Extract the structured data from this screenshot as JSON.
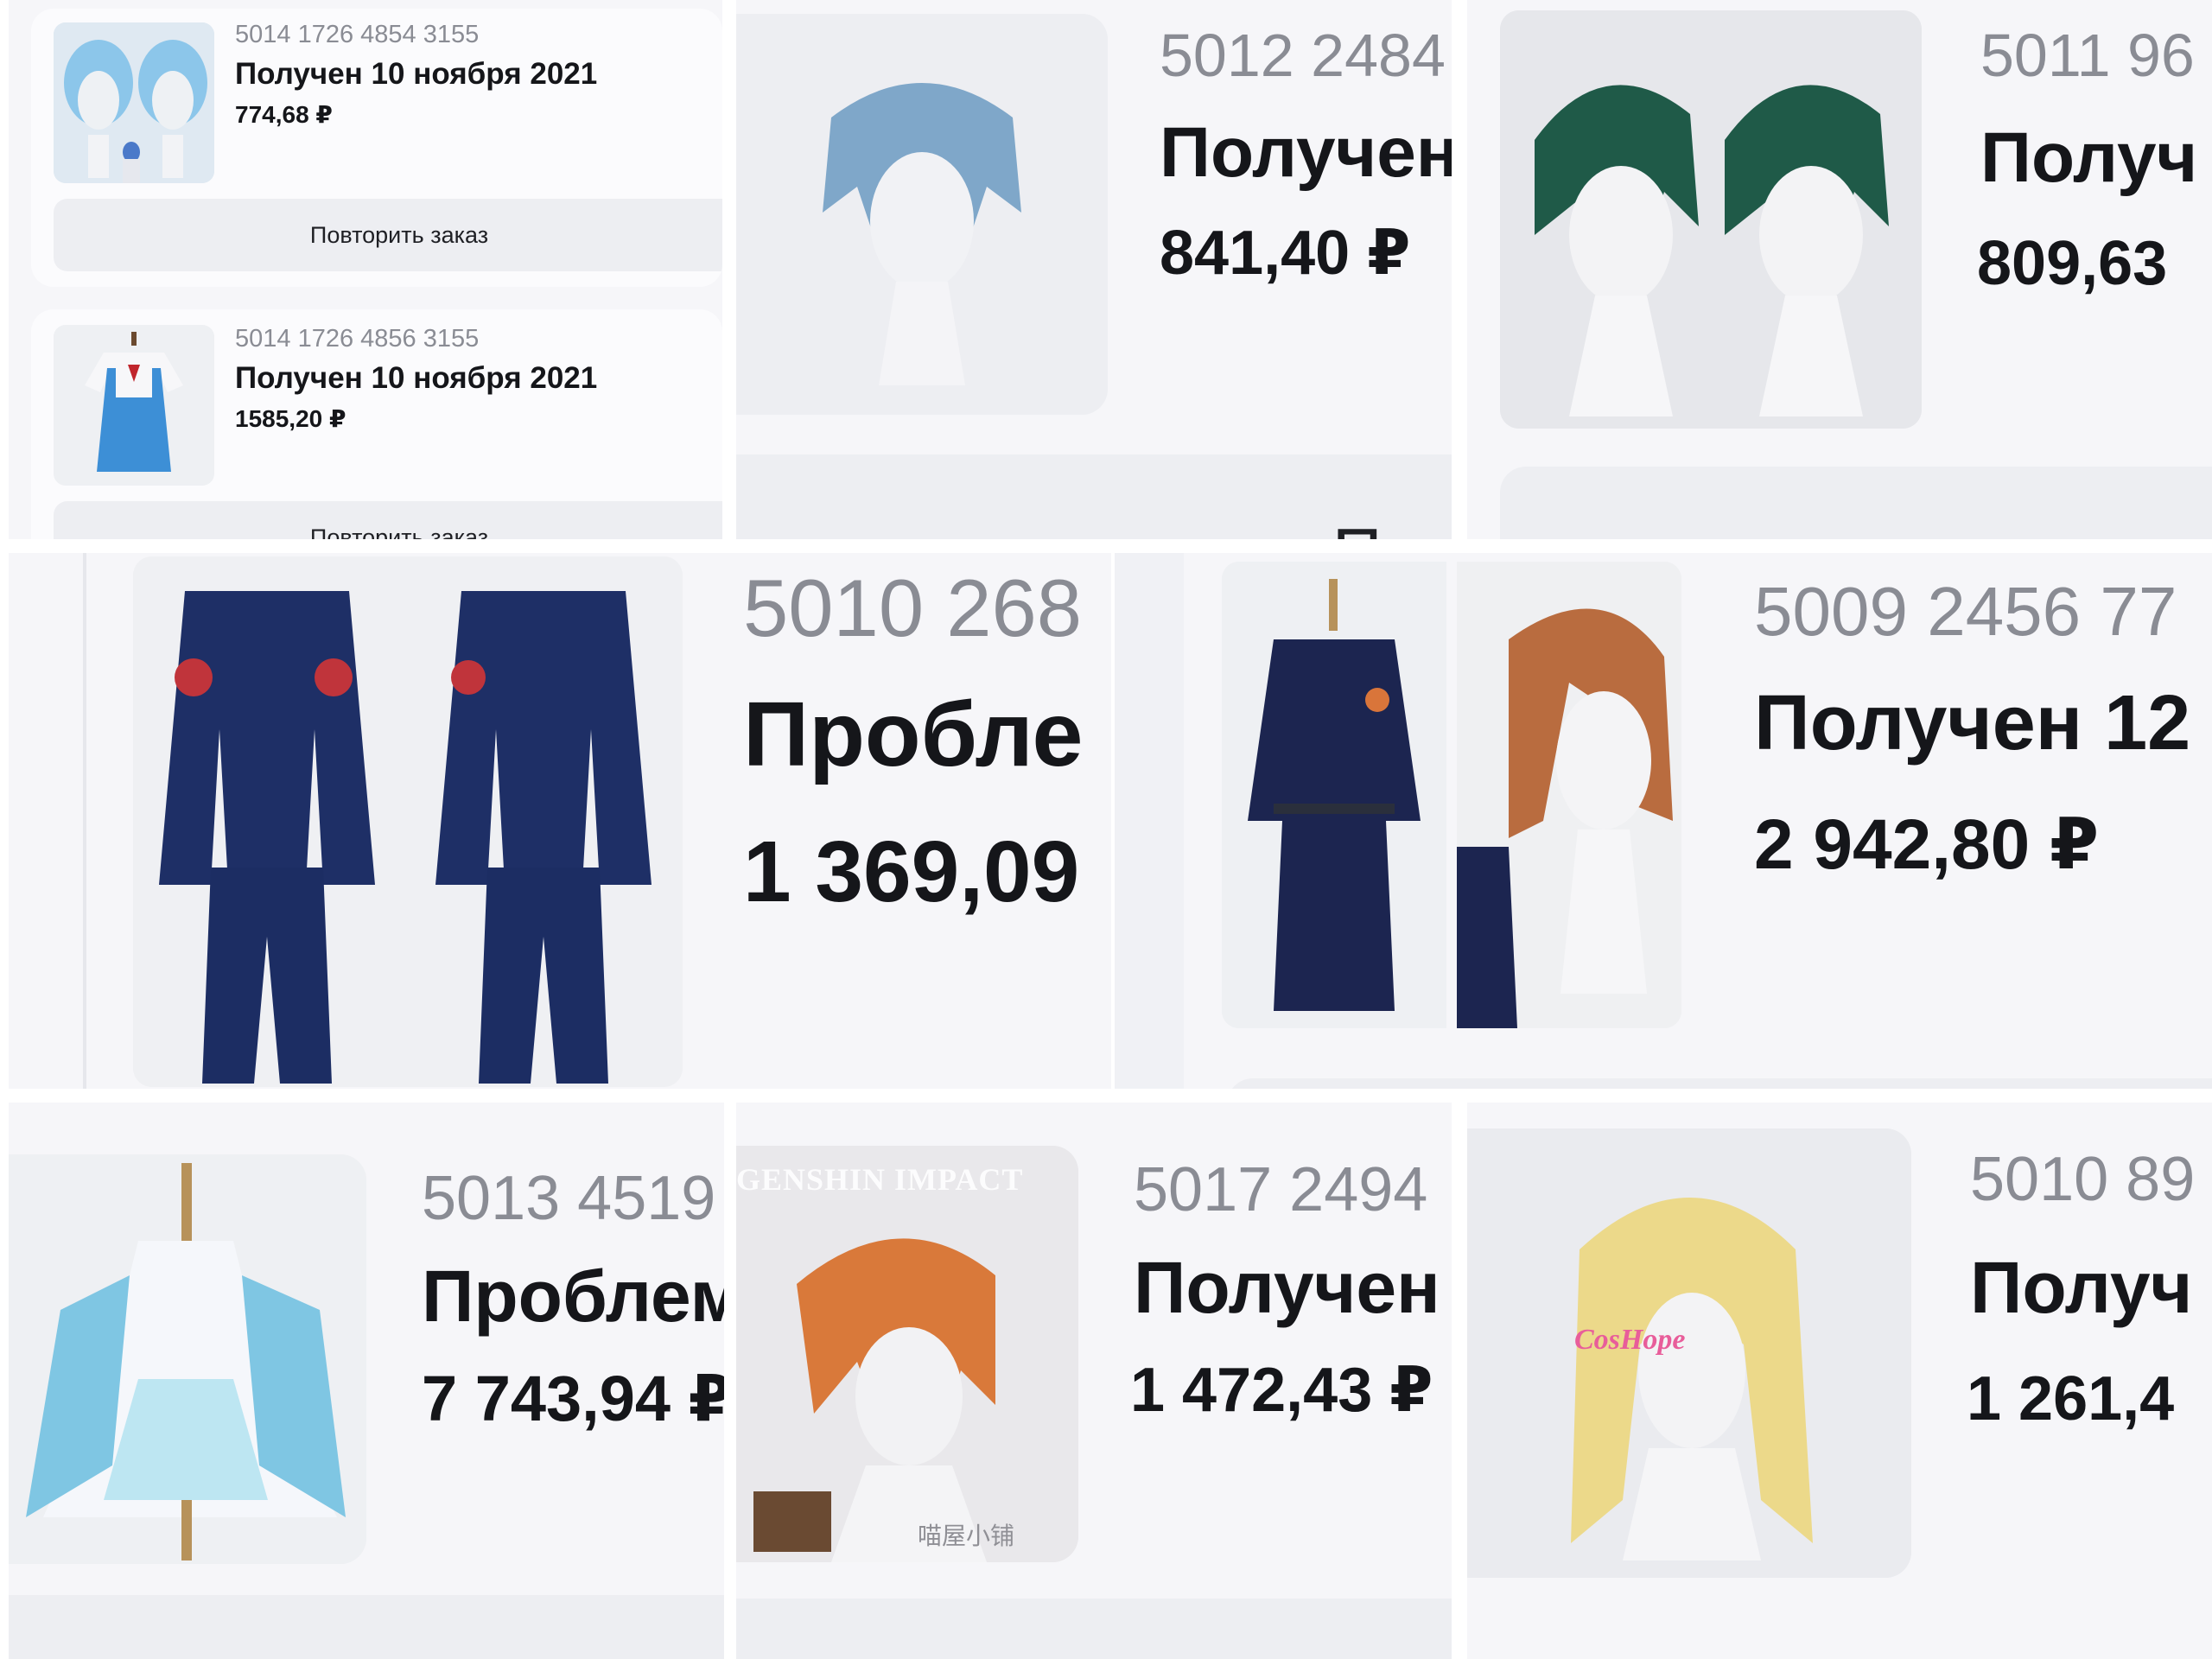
{
  "orders": [
    {
      "number": "5014 1726 4854 3155",
      "status": "Получен 10 ноября 2021",
      "price": "774,68 ₽",
      "button": "Повторить заказ",
      "icon": "blue-wig-image"
    },
    {
      "number": "5014 1726 4856 3155",
      "status": "Получен 10 ноября 2021",
      "price": "1585,20 ₽",
      "button": "Повторить заказ",
      "icon": "school-uniform-image"
    },
    {
      "number": "5012 2484",
      "status": "Получен",
      "price": "841,40 ₽",
      "button": "Повт",
      "icon": "light-blue-wig-image"
    },
    {
      "number": "5011 96",
      "status": "Получ",
      "price": "809,63",
      "icon": "green-wig-image"
    },
    {
      "number": "5010 268",
      "status": "Пробле",
      "price": "1 369,09",
      "icon": "navy-uniform-image"
    },
    {
      "number": "5009 2456 77",
      "status": "Получен 12",
      "price": "2 942,80 ₽",
      "icon": "brown-wig-image"
    },
    {
      "number": "5013 4519",
      "status": "Проблем",
      "price": "7 743,94 ₽",
      "icon": "dress-costume-image"
    },
    {
      "number": "5017 2494",
      "status": "Получен",
      "price": "1 472,43 ₽",
      "icon": "orange-wig-image",
      "watermark": "GENSHIN IMPACT",
      "watermark_small": "喵屋小铺"
    },
    {
      "number": "5010 89",
      "status": "Получ",
      "price": "1 261,4",
      "icon": "blonde-wig-image",
      "watermark": "CosHope"
    }
  ],
  "colors": {
    "page": "#ffffff",
    "card": "#fbfbfd",
    "thumb": "#e9eaef",
    "button": "#edeef2",
    "muted": "#8a8c94",
    "text": "#15161a"
  }
}
